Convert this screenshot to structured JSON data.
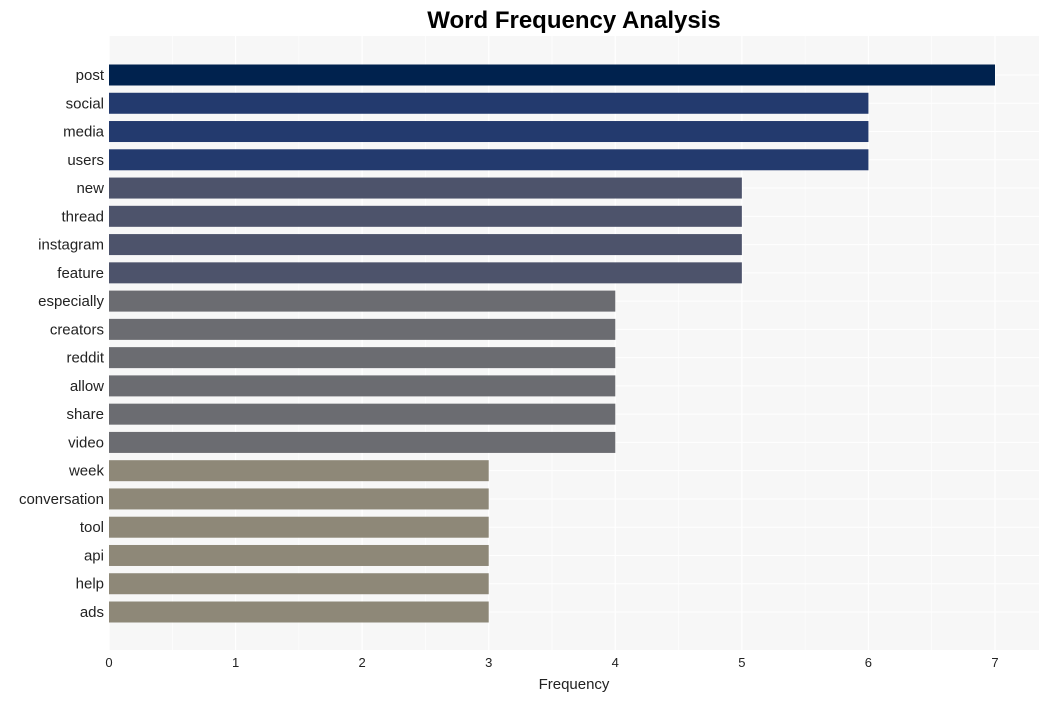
{
  "chart_data": {
    "type": "bar",
    "orientation": "horizontal",
    "title": "Word Frequency Analysis",
    "xlabel": "Frequency",
    "ylabel": "",
    "xlim": [
      0,
      7.35
    ],
    "xticks": [
      0,
      1,
      2,
      3,
      4,
      5,
      6,
      7
    ],
    "grid": true,
    "categories": [
      "post",
      "social",
      "media",
      "users",
      "new",
      "thread",
      "instagram",
      "feature",
      "especially",
      "creators",
      "reddit",
      "allow",
      "share",
      "video",
      "week",
      "conversation",
      "tool",
      "api",
      "help",
      "ads"
    ],
    "values": [
      7,
      6,
      6,
      6,
      5,
      5,
      5,
      5,
      4,
      4,
      4,
      4,
      4,
      4,
      3,
      3,
      3,
      3,
      3,
      3
    ],
    "colors_by_value": {
      "7": "#00224e",
      "6": "#233a6e",
      "5": "#4d536b",
      "4": "#6b6c71",
      "3": "#8e8878"
    }
  }
}
